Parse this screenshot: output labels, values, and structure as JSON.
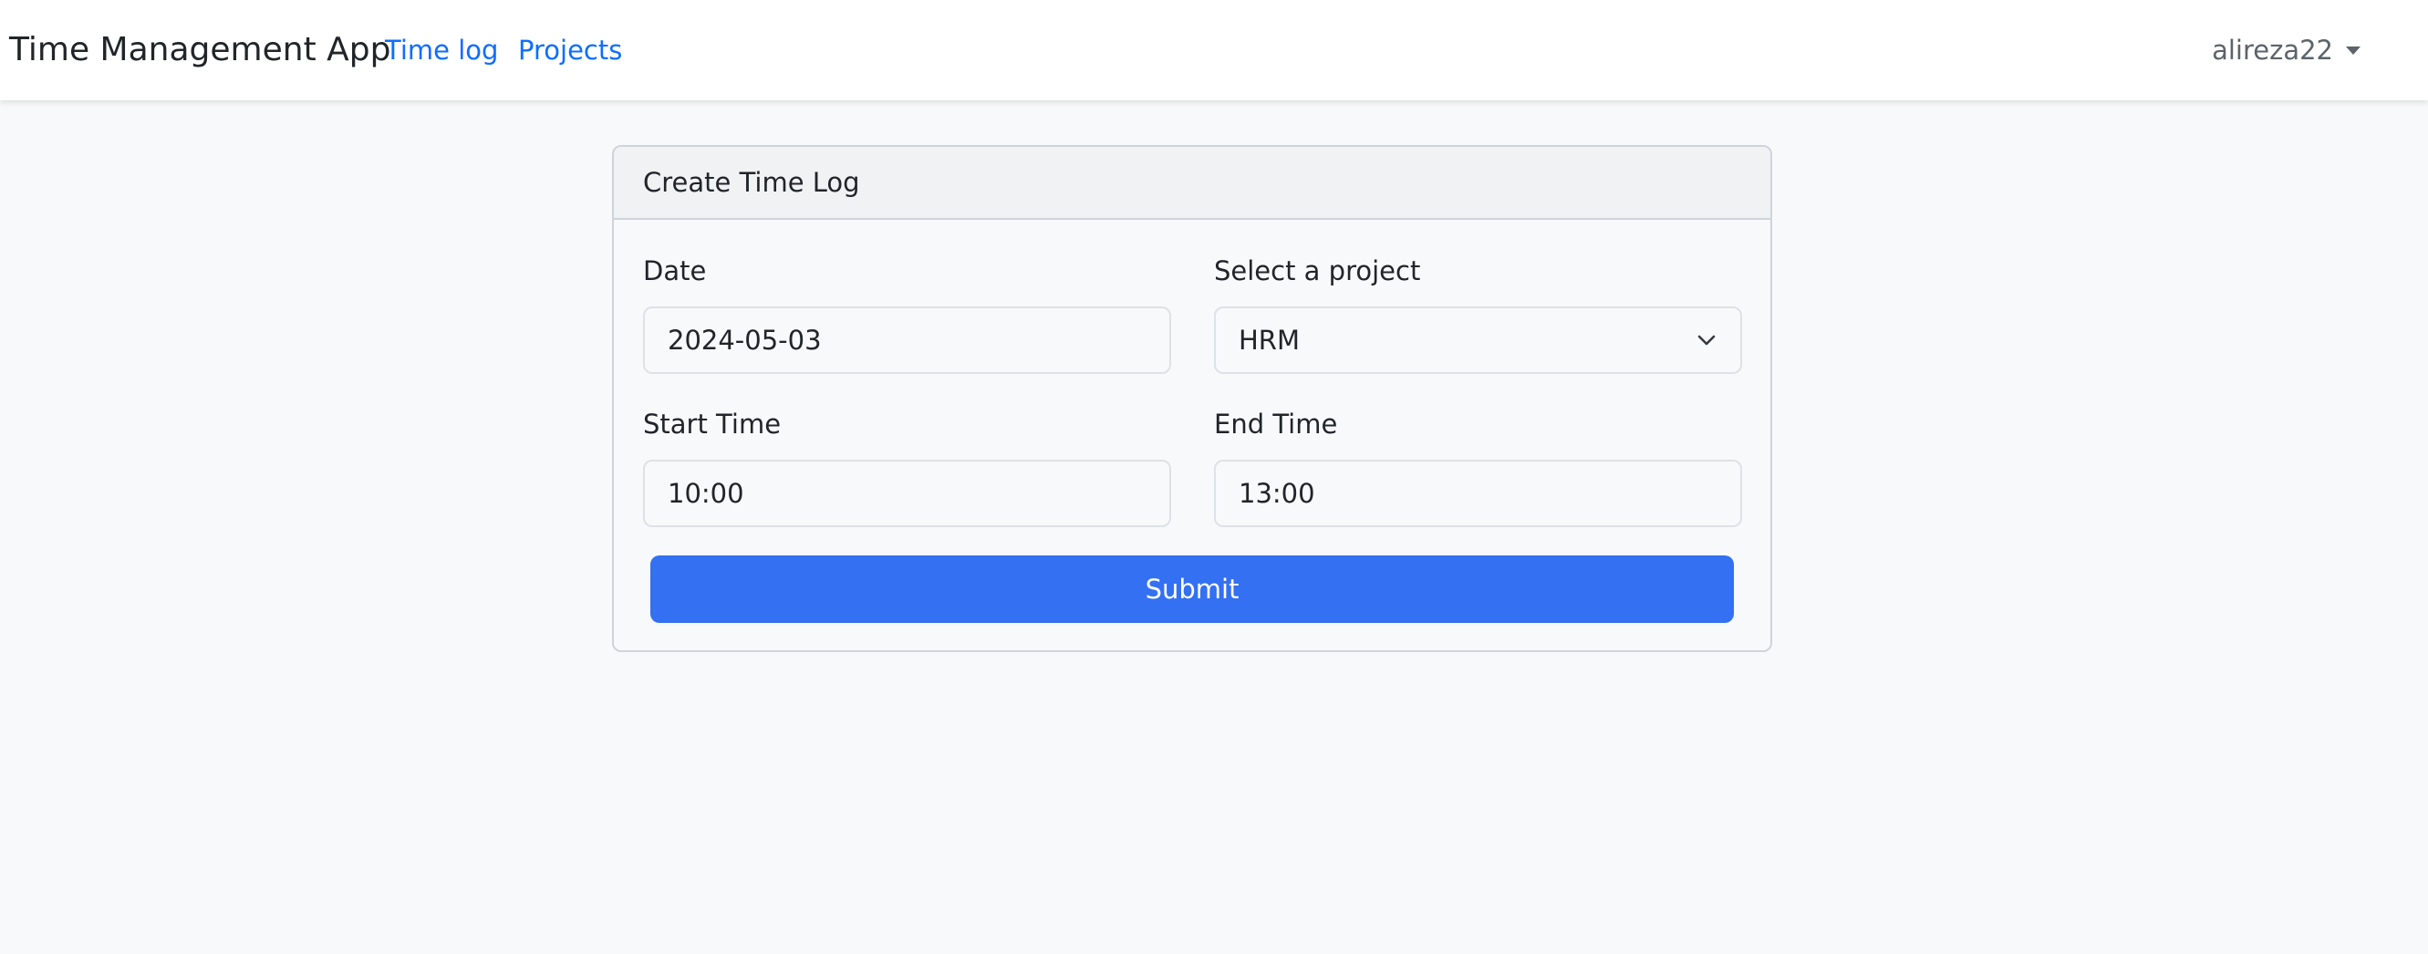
{
  "navbar": {
    "brand": "Time Management App",
    "links": [
      {
        "label": "Time log"
      },
      {
        "label": "Projects"
      }
    ],
    "user": {
      "name": "alireza22"
    }
  },
  "form": {
    "title": "Create Time Log",
    "date": {
      "label": "Date",
      "value": "2024-05-03"
    },
    "project": {
      "label": "Select a project",
      "selected": "HRM"
    },
    "start_time": {
      "label": "Start Time",
      "value": "10:00"
    },
    "end_time": {
      "label": "End Time",
      "value": "13:00"
    },
    "submit_label": "Submit"
  },
  "colors": {
    "primary": "#3370f2",
    "link": "#0d6efd",
    "background": "#f8f9fa"
  },
  "icons": {
    "user_menu": "caret-down-icon",
    "select": "chevron-down-icon"
  }
}
